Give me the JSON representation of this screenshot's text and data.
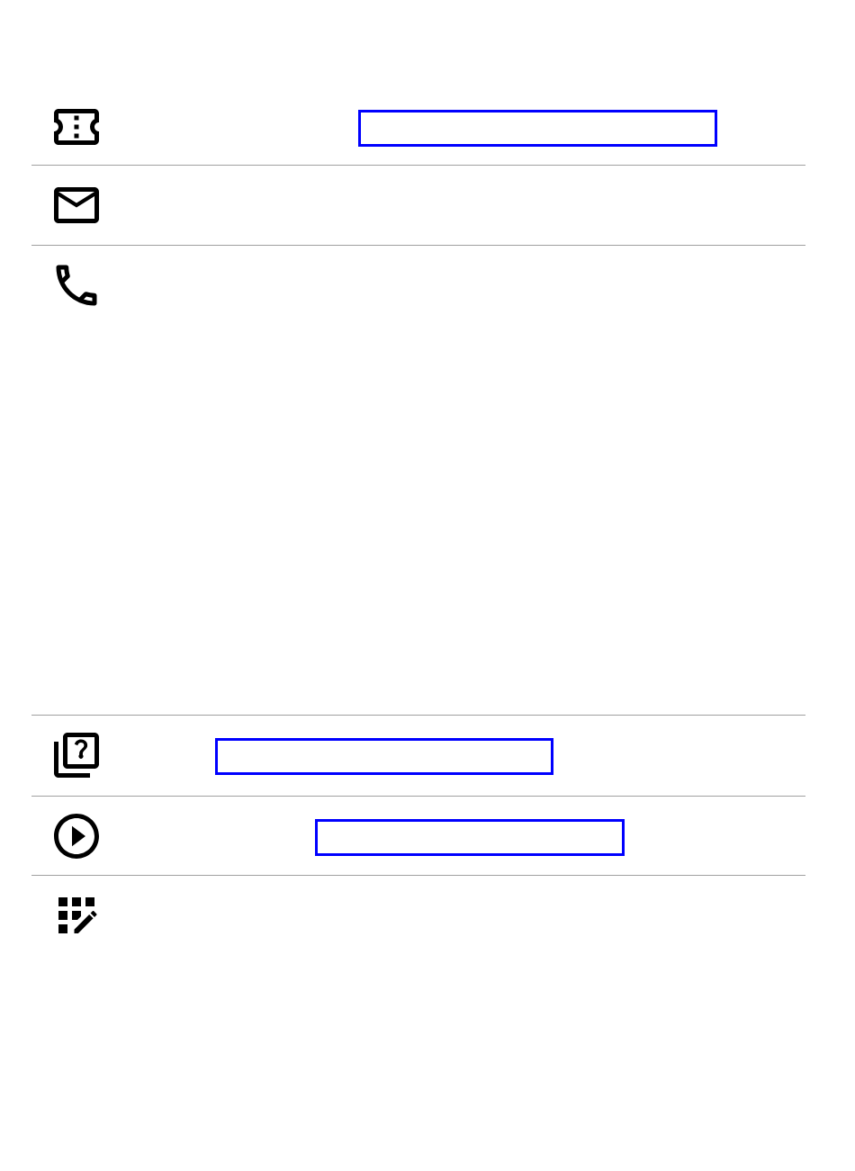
{
  "rows": [
    {
      "kind": "ticket",
      "highlighted": true
    },
    {
      "kind": "mail",
      "highlighted": false
    },
    {
      "kind": "phone",
      "highlighted": false
    },
    {
      "kind": "quiz",
      "highlighted": true
    },
    {
      "kind": "play",
      "highlighted": true
    },
    {
      "kind": "grid-edit",
      "highlighted": false
    }
  ]
}
